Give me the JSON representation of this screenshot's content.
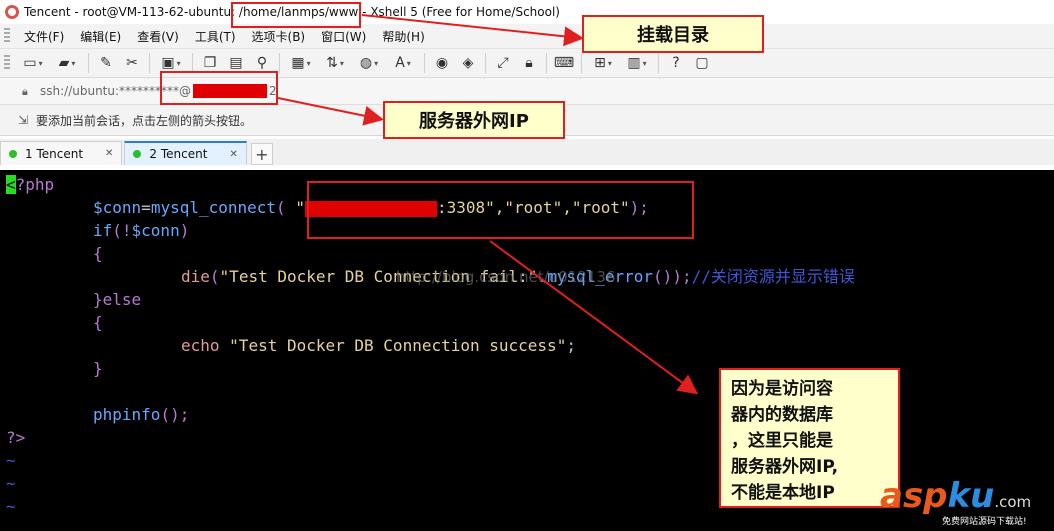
{
  "window": {
    "title": "Tencent - root@VM-113-62-ubuntu: /home/lanmps/www - Xshell 5 (Free for Home/School)"
  },
  "menu": [
    "文件(F)",
    "编辑(E)",
    "查看(V)",
    "工具(T)",
    "选项卡(B)",
    "窗口(W)",
    "帮助(H)"
  ],
  "address": {
    "prefix": "ssh://ubuntu:**********@",
    "suffix": "2"
  },
  "hint": "要添加当前会话，点击左侧的箭头按钮。",
  "tabs": [
    {
      "label": "1 Tencent",
      "active": false
    },
    {
      "label": "2 Tencent",
      "active": true
    }
  ],
  "tab_add": "+",
  "code": {
    "open_tag_cursor": "<",
    "open_tag_rest": "?php",
    "conn_var": "$conn",
    "conn_eq": "=",
    "conn_fn": "mysql_connect",
    "conn_paren": "(",
    "conn_q1": "\"",
    "conn_rest": ":3308\",\"root\",\"root\"",
    "conn_close": ");",
    "if_kw": "if",
    "if_rest_a": "(!",
    "if_var": "$conn",
    "if_rest_b": ")",
    "brace_open_1": "{",
    "die_fn": "die",
    "die_paren": "(",
    "die_str": "\"Test Docker DB Connection fail:\"",
    "die_dot": ".",
    "die_err": "mysql_error",
    "die_close": "());",
    "die_comment": "//关闭资源并显示错误",
    "else_line": "}else",
    "brace_open_2": "{",
    "echo_kw": "echo",
    "echo_str": "\"Test Docker DB Connection success\"",
    "echo_semi": ";",
    "brace_close": "}",
    "phpinfo_fn": "phpinfo",
    "phpinfo_close": "();",
    "close_tag": "?>",
    "tilde": "~"
  },
  "watermark": "http://blog.csdn.net/u012136",
  "callouts": {
    "mount_dir": "挂载目录",
    "server_ip": "服务器外网IP",
    "explain": "因为是访问容\n器内的数据库\n，这里只能是\n服务器外网IP,\n不能是本地IP"
  },
  "logo": {
    "a": "asp",
    "b": "ku",
    "dotcom": ".com",
    "slogan": "免费网站源码下载站!"
  },
  "colors": {
    "annotation_red": "#e02020",
    "callout_fill": "#ffffcc",
    "terminal_bg": "#000000",
    "cursor_green": "#22dd22"
  }
}
